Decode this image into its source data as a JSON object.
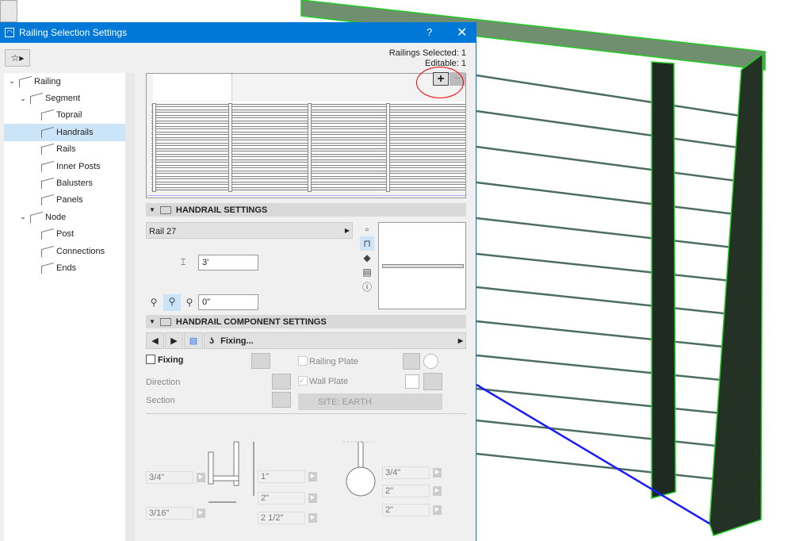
{
  "dialog": {
    "title": "Railing Selection Settings",
    "help": "?",
    "close": "✕",
    "status": {
      "selected": "Railings Selected: 1",
      "editable": "Editable: 1"
    }
  },
  "tree": [
    {
      "label": "Railing",
      "level": 0,
      "expanded": true
    },
    {
      "label": "Segment",
      "level": 1,
      "expanded": true
    },
    {
      "label": "Toprail",
      "level": 2
    },
    {
      "label": "Handrails",
      "level": 2,
      "selected": true
    },
    {
      "label": "Rails",
      "level": 2
    },
    {
      "label": "Inner Posts",
      "level": 2
    },
    {
      "label": "Balusters",
      "level": 2
    },
    {
      "label": "Panels",
      "level": 2
    },
    {
      "label": "Node",
      "level": 1,
      "expanded": true
    },
    {
      "label": "Post",
      "level": 2
    },
    {
      "label": "Connections",
      "level": 2
    },
    {
      "label": "Ends",
      "level": 2
    }
  ],
  "preview": {
    "add": "+",
    "remove": "−"
  },
  "handrail": {
    "header": "HANDRAIL SETTINGS",
    "profile": "Rail 27",
    "height": "3'",
    "offset": "0\""
  },
  "component": {
    "header": "HANDRAIL COMPONENT SETTINGS",
    "selector": "Fixing...",
    "fixing": "Fixing",
    "direction": "Direction",
    "section": "Section",
    "railing_plate": "Railing Plate",
    "wall_plate": "Wall Plate",
    "material": "SITE: EARTH",
    "dims_left": [
      "3/4\"",
      "3/16\""
    ],
    "dims_mid": [
      "1\"",
      "2\"",
      "2 1/2\""
    ],
    "dims_right": [
      "3/4\"",
      "2\"",
      "2\""
    ]
  },
  "colors": {
    "titlebar": "#0078d7",
    "selection": "#cce4f7",
    "railing": "#3d8a3d",
    "highlight": "#22cc22"
  }
}
